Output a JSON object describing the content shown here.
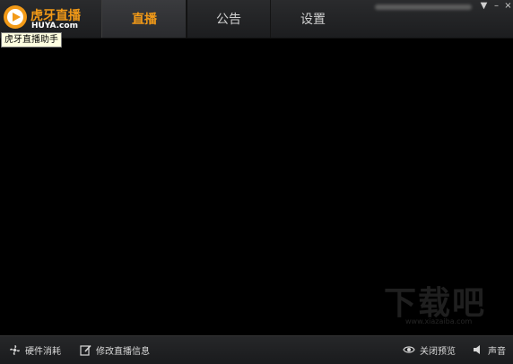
{
  "app": {
    "logo_title": "虎牙直播",
    "logo_domain": "HUYA.com",
    "tooltip": "虎牙直播助手"
  },
  "tabs": [
    {
      "label": "直播",
      "active": true
    },
    {
      "label": "公告",
      "active": false
    },
    {
      "label": "设置",
      "active": false
    }
  ],
  "window_controls": {
    "menu": "▼",
    "minimize": "–",
    "close": "×"
  },
  "bottom_bar": {
    "hardware_label": "硬件消耗",
    "edit_info_label": "修改直播信息",
    "close_preview_label": "关闭预览",
    "sound_label": "声音"
  },
  "watermark": {
    "text": "下载吧",
    "url": "www.xiazaiba.com"
  },
  "colors": {
    "accent": "#f39a17",
    "topbar": "#2a2b2d",
    "preview_bg": "#000000",
    "tooltip_bg": "#ffffe1"
  },
  "icons": {
    "logo": "huya-logo-icon",
    "hardware": "fan-icon",
    "edit": "edit-icon",
    "preview": "eye-icon",
    "sound": "speaker-icon"
  }
}
